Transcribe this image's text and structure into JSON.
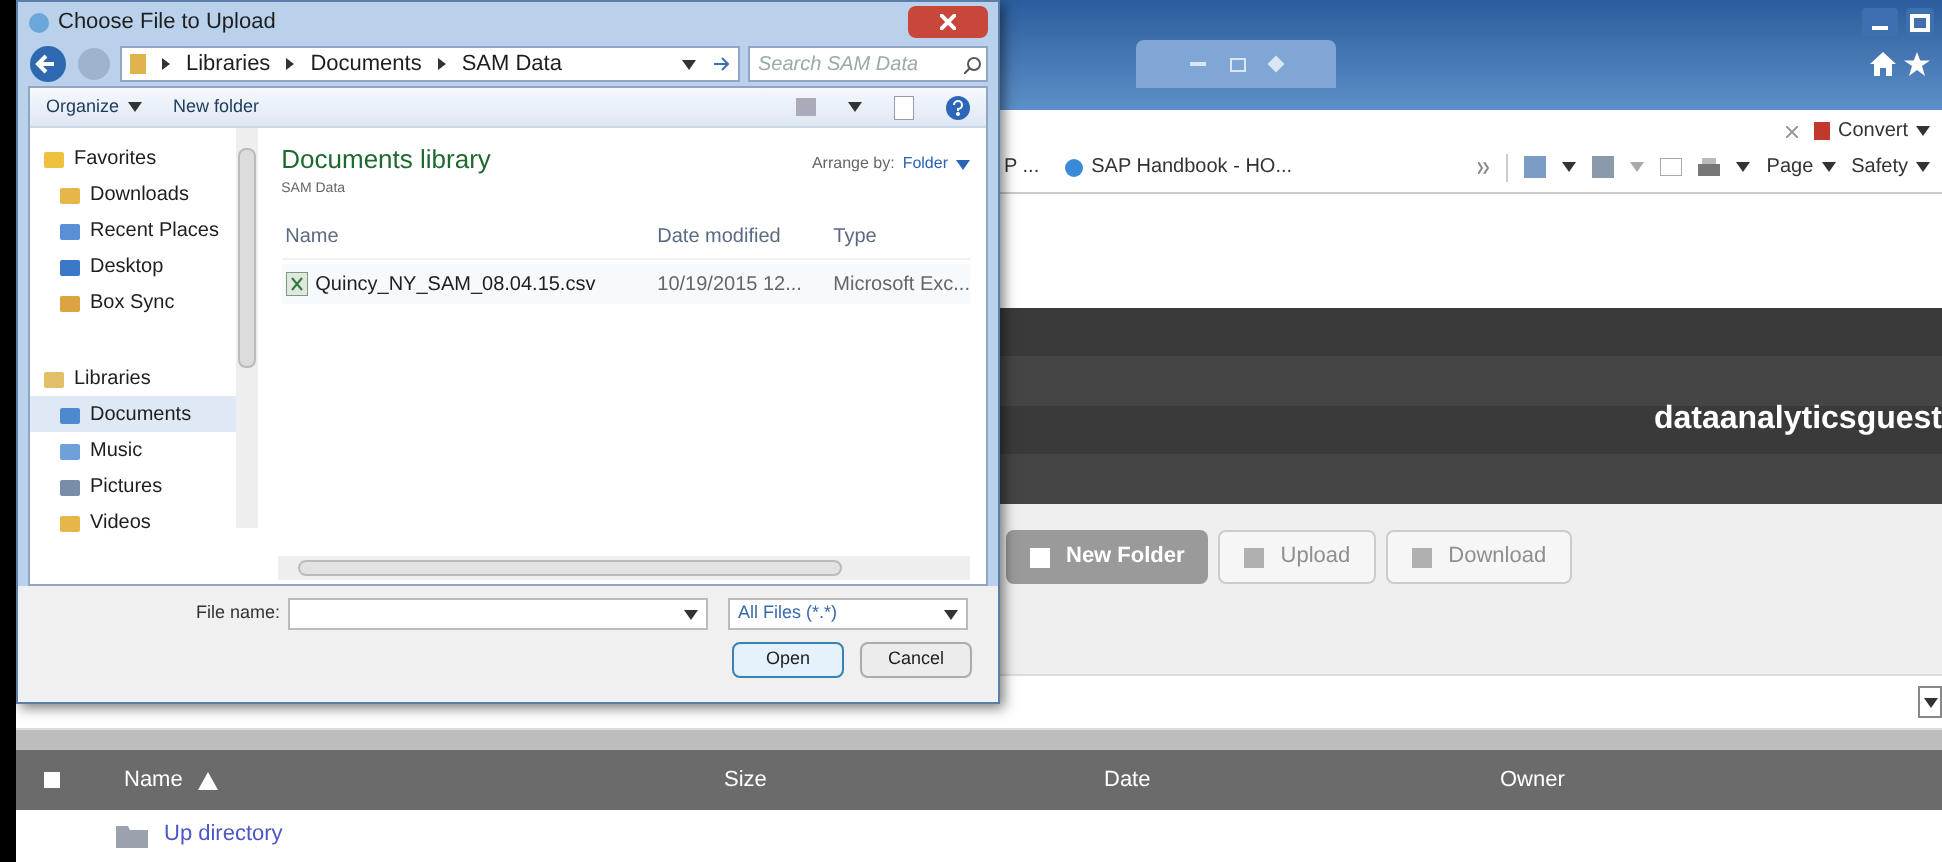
{
  "browser": {
    "favorites": [
      {
        "label": "P ..."
      },
      {
        "label": "SAP Handbook - HO..."
      }
    ],
    "convert": "Convert",
    "commands": [
      {
        "label": "Page"
      },
      {
        "label": "Safety"
      }
    ]
  },
  "page": {
    "user": "dataanalyticsguest",
    "buttons": [
      {
        "label": "New Folder",
        "disabled": false
      },
      {
        "label": "Upload",
        "disabled": true
      },
      {
        "label": "Download",
        "disabled": true
      }
    ],
    "table": {
      "select_all": {
        "checked": false
      },
      "columns": [
        "Name",
        "Size",
        "Date",
        "Owner"
      ],
      "rows": [
        {
          "name": "Up directory"
        }
      ]
    }
  },
  "dialog": {
    "title": "Choose File to Upload",
    "breadcrumb": [
      "Libraries",
      "Documents",
      "SAM Data"
    ],
    "search": {
      "placeholder": "Search SAM Data"
    },
    "toolbar": [
      {
        "label": "Organize",
        "menu": true
      },
      {
        "label": "New folder",
        "menu": false
      }
    ],
    "sidebar": [
      {
        "label": "Favorites",
        "children": [
          {
            "label": "Downloads",
            "selected": false
          },
          {
            "label": "Recent Places",
            "selected": false
          },
          {
            "label": "Desktop",
            "selected": false
          },
          {
            "label": "Box Sync",
            "selected": false
          }
        ]
      },
      {
        "label": "Libraries",
        "children": [
          {
            "label": "Documents",
            "selected": true
          },
          {
            "label": "Music",
            "selected": false
          },
          {
            "label": "Pictures",
            "selected": false
          },
          {
            "label": "Videos",
            "selected": false
          }
        ]
      }
    ],
    "library": {
      "title": "Documents library",
      "subtitle": "SAM Data",
      "arrange_label": "Arrange by:",
      "arrange_value": "Folder"
    },
    "columns": [
      "Name",
      "Date modified",
      "Type"
    ],
    "files": [
      {
        "name": "Quincy_NY_SAM_08.04.15.csv",
        "date": "10/19/2015 12...",
        "type": "Microsoft Exc...",
        "selected": false
      }
    ],
    "file_name_label": "File name:",
    "filter": "All Files (*.*)",
    "buttons": [
      {
        "label": "Open",
        "default": true
      },
      {
        "label": "Cancel",
        "default": false
      }
    ]
  }
}
